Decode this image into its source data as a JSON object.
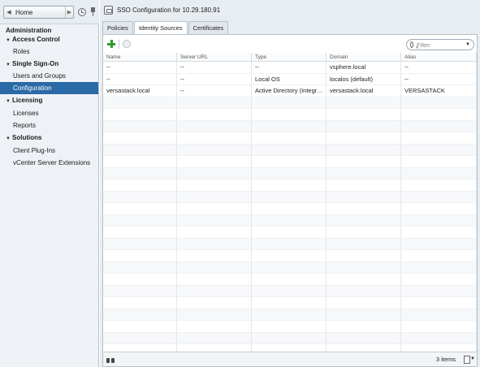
{
  "nav": {
    "home_label": "Home",
    "heading": "Administration",
    "groups": [
      {
        "label": "Access Control",
        "items": [
          "Roles"
        ]
      },
      {
        "label": "Single Sign-On",
        "items": [
          "Users and Groups",
          "Configuration"
        ]
      },
      {
        "label": "Licensing",
        "items": [
          "Licenses",
          "Reports"
        ]
      },
      {
        "label": "Solutions",
        "items": [
          "Client Plug-Ins",
          "vCenter Server Extensions"
        ]
      }
    ],
    "selected": "Configuration"
  },
  "main": {
    "title": "SSO Configuration for 10.29.180.91",
    "tabs": [
      "Policies",
      "Identity Sources",
      "Certificates"
    ],
    "active_tab": "Identity Sources",
    "filter_placeholder": "Filter",
    "columns": [
      "Name",
      "Server URL",
      "Type",
      "Domain",
      "Alias"
    ],
    "rows": [
      [
        "--",
        "--",
        "--",
        "vsphere.local",
        "--"
      ],
      [
        "--",
        "--",
        "Local OS",
        "localos (default)",
        "--"
      ],
      [
        "versastack.local",
        "--",
        "Active Directory (Integrated ...",
        "versastack.local",
        "VERSASTACK"
      ]
    ],
    "item_count": "3 items"
  },
  "colors": {
    "selected_bg": "#2a6aa6",
    "add_icon": "#2e9c2e",
    "panel_bg": "#e8edf2"
  }
}
